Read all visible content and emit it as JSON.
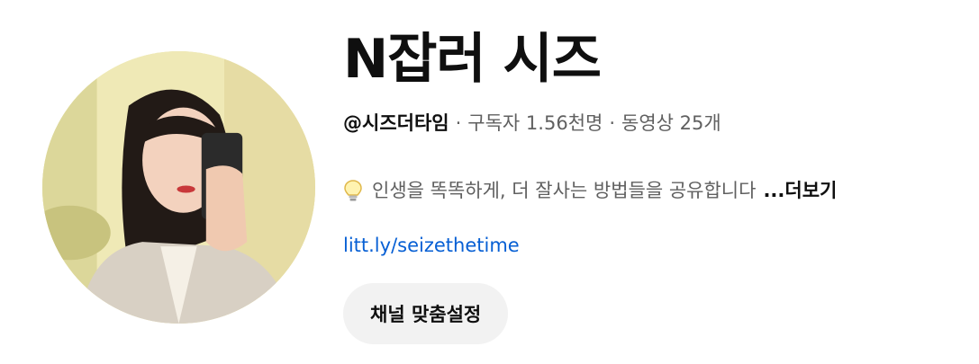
{
  "channel": {
    "name": "N잡러 시즈",
    "handle": "@시즈더타임",
    "subscribers": "구독자 1.56천명",
    "videos": "동영상 25개",
    "separator": "·",
    "description": "인생을 똑똑하게, 더 잘사는 방법들을 공유합니다",
    "more_label": "...더보기",
    "link": "litt.ly/seizethetime",
    "customize_button": "채널 맞춤설정"
  },
  "icons": {
    "description_icon": "lightbulb-icon"
  },
  "colors": {
    "link": "#065fd4",
    "button_bg": "#f2f2f2",
    "secondary_text": "#606060"
  }
}
